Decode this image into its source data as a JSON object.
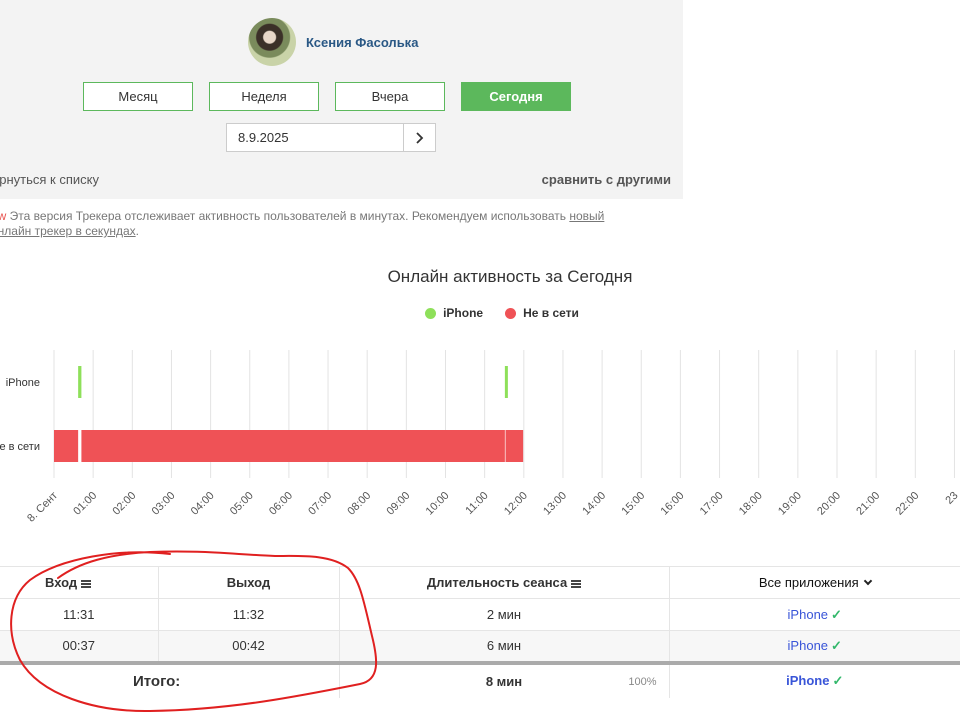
{
  "user": {
    "name": "Ксения Фасолька"
  },
  "periods": [
    {
      "label": "Месяц",
      "active": false
    },
    {
      "label": "Неделя",
      "active": false
    },
    {
      "label": "Вчера",
      "active": false
    },
    {
      "label": "Сегодня",
      "active": true
    }
  ],
  "date": {
    "value": "8.9.2025"
  },
  "links": {
    "back": "ернуться к списку",
    "compare": "сравнить с другими"
  },
  "notice": {
    "tag": "ew",
    "text": " Эта версия Трекера отслеживает активность пользователей в минутах. Рекомендуем использовать ",
    "link1": "новый",
    "link2": "онлайн трекер в секундах",
    "end": "."
  },
  "colors": {
    "accent": "#5cb85c",
    "online": "#8ee05a",
    "offline": "#ef5256",
    "link": "#3955d8"
  },
  "chart_data": {
    "type": "timeline",
    "title": "Онлайн активность за Сегодня",
    "legend": [
      {
        "name": "iPhone",
        "color": "#8ee05a"
      },
      {
        "name": "Не в сети",
        "color": "#ef5256"
      }
    ],
    "rows": [
      "iPhone",
      "е в сети"
    ],
    "x_ticks": [
      "8. Сент",
      "01:00",
      "02:00",
      "03:00",
      "04:00",
      "05:00",
      "06:00",
      "07:00",
      "08:00",
      "09:00",
      "10:00",
      "11:00",
      "12:00",
      "13:00",
      "14:00",
      "15:00",
      "16:00",
      "17:00",
      "18:00",
      "19:00",
      "20:00",
      "21:00",
      "22:00",
      "23"
    ],
    "x_range_hours": [
      0,
      24
    ],
    "segments": [
      {
        "row": 0,
        "start": "00:37",
        "end": "00:42"
      },
      {
        "row": 0,
        "start": "11:31",
        "end": "11:32"
      },
      {
        "row": 1,
        "start": "00:00",
        "end": "00:37"
      },
      {
        "row": 1,
        "start": "00:42",
        "end": "11:31"
      },
      {
        "row": 1,
        "start": "11:32",
        "end": "11:59"
      }
    ]
  },
  "table": {
    "headers": {
      "enter": "Вход",
      "exit": "Выход",
      "duration": "Длительность сеанса",
      "apps": "Все приложения"
    },
    "rows": [
      {
        "enter": "11:31",
        "exit": "11:32",
        "duration": "2 мин",
        "app": "iPhone"
      },
      {
        "enter": "00:37",
        "exit": "00:42",
        "duration": "6 мин",
        "app": "iPhone"
      }
    ],
    "total": {
      "label": "Итого:",
      "duration": "8 мин",
      "percent": "100%",
      "app": "iPhone"
    }
  }
}
